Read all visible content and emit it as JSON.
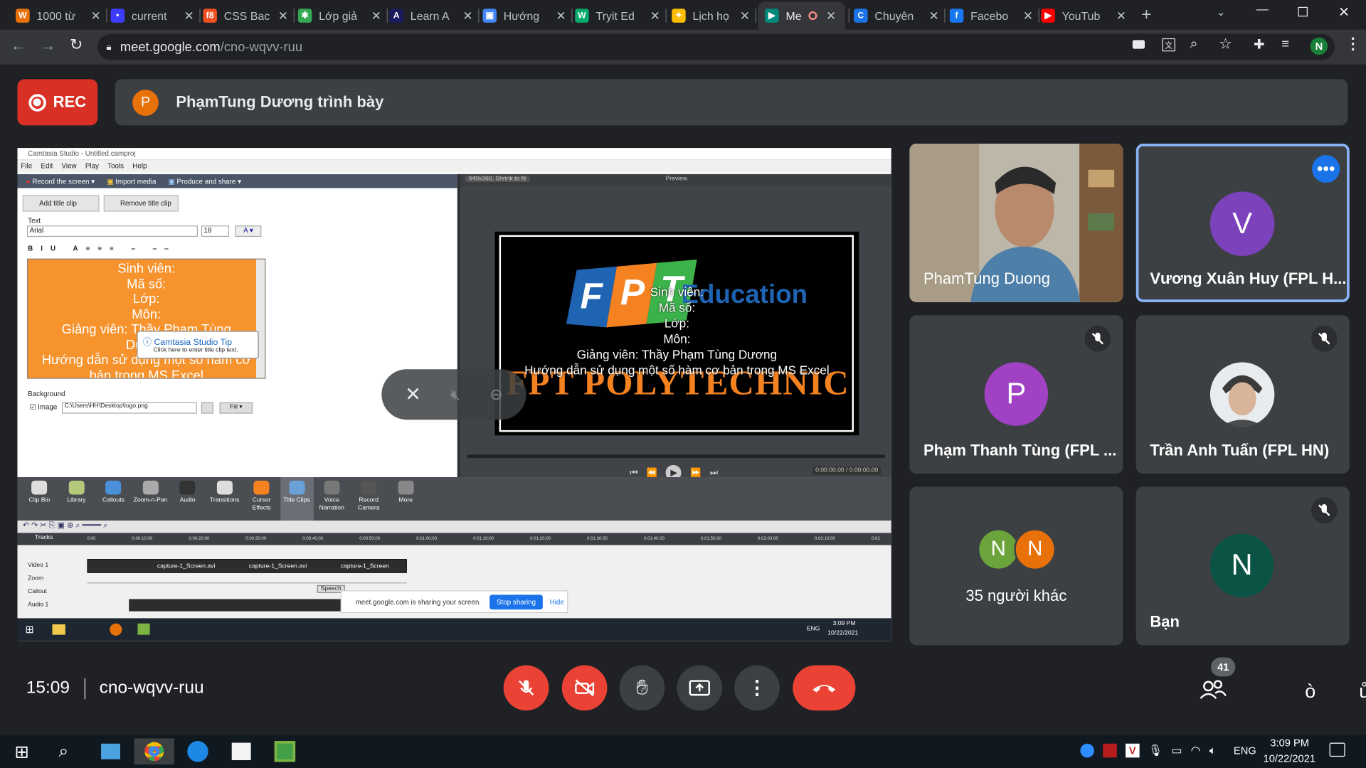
{
  "browser": {
    "tabs": [
      {
        "title": "1000 từ",
        "color": "#e8710a",
        "glyph": "W"
      },
      {
        "title": "current",
        "color": "#3c3cff",
        "glyph": "•"
      },
      {
        "title": "CSS Bac",
        "color": "#f05123",
        "glyph": "f8"
      },
      {
        "title": "Lớp giả",
        "color": "#34a853",
        "glyph": "✱"
      },
      {
        "title": "Learn A",
        "color": "#1a1a5e",
        "glyph": "A"
      },
      {
        "title": "Hướng",
        "color": "#4285f4",
        "glyph": "▣"
      },
      {
        "title": "Tryit Ed",
        "color": "#04aa6d",
        "glyph": "W"
      },
      {
        "title": "Lịch họ",
        "color": "#fbbc04",
        "glyph": "✦"
      },
      {
        "title": "Me",
        "color": "#00897b",
        "glyph": "▶"
      },
      {
        "title": "Chuyên",
        "color": "#1a73e8",
        "glyph": "C"
      },
      {
        "title": "Facebo",
        "color": "#1877f2",
        "glyph": "f"
      },
      {
        "title": "YouTub",
        "color": "#ff0000",
        "glyph": "▶"
      }
    ],
    "url_domain": "meet.google.com",
    "url_path": "/cno-wqvv-ruu",
    "profile_initial": "N"
  },
  "meeting": {
    "rec_label": "REC",
    "presenter_initial": "P",
    "presenter_text": "PhạmTung Dương trình bày",
    "clock": "15:09",
    "code": "cno-wqvv-ruu",
    "participant_count": "41",
    "right_char": "ò",
    "edge_char": "ů"
  },
  "tiles": [
    {
      "name": "PhamTung Duong",
      "type": "video"
    },
    {
      "name": "Vương Xuân Huy (FPL H...",
      "initial": "V",
      "color": "#7b42bc"
    },
    {
      "name": "Phạm Thanh Tùng (FPL ...",
      "initial": "P",
      "color": "#a142c4"
    },
    {
      "name": "Trần Anh Tuấn (FPL HN)",
      "type": "photo"
    },
    {
      "name": "35 người khác",
      "initials": [
        "N",
        "N"
      ],
      "colors": [
        "#6ba43a",
        "#e8710a"
      ]
    },
    {
      "name": "Bạn",
      "initial": "N",
      "color": "#0b5345"
    }
  ],
  "camtasia": {
    "title": "Camtasia Studio - Untitled.camproj",
    "menu": [
      "File",
      "Edit",
      "View",
      "Play",
      "Tools",
      "Help"
    ],
    "record_label": "Record the screen",
    "import_label": "Import media",
    "produce_label": "Produce and share",
    "add_title_clip": "Add title clip",
    "remove_title_clip": "Remove title clip",
    "text_label": "Text",
    "font": "Arial",
    "font_size": "18",
    "editor_lines": [
      "Sinh viên:",
      "Mã số:",
      "Lớp:",
      "Môn:",
      "Giảng viên: Thầy Phạm Tùng",
      "Dương",
      "Hướng dẫn sử dụng một số hàm cơ",
      "bản trong MS Excel"
    ],
    "tip_title": "Camtasia Studio Tip",
    "tip_text": "Click here to enter title clip text.",
    "background_label": "Background",
    "image_label": "Image",
    "image_path": "C:\\Users\\HH\\Desktop\\logo.png",
    "fill_label": "Fill",
    "preview_size": "640x360, Shrink to fit",
    "preview_label": "Preview",
    "preview_lines": [
      "Sinh viên:",
      "Mã số:",
      "Lớp:",
      "Môn:",
      "Giảng viên: Thầy Phạm Tùng Dương",
      "Hướng dẫn sử dụng một số hàm cơ bản trong MS Excel"
    ],
    "logo_letters": [
      "F",
      "P",
      "T"
    ],
    "logo_education": "Education",
    "logo_poly": "FPT POLYTECHNIC",
    "time_display": "0:00:00.00 / 0:00:00.00",
    "tools": [
      "Clip Bin",
      "Library",
      "Callouts",
      "Zoom-n-Pan",
      "Audio",
      "Transitions",
      "Cursor Effects",
      "Title Clips",
      "Voice Narration",
      "Record Camera",
      "More"
    ],
    "tracks_label": "Tracks",
    "track_names": [
      "Video 1",
      "Zoom",
      "Callout",
      "Audio 1"
    ],
    "ruler": [
      "0:00",
      "0:00:10;00",
      "0:00:20;00",
      "0:00:30;00",
      "0:00:40;00",
      "0:00:50;00",
      "0:01:00;00",
      "0:01:10;00",
      "0:01:20;00",
      "0:01:30;00",
      "0:01:40;00",
      "0:01:50;00",
      "0:02:00;00",
      "0:02:10;00",
      "0:02"
    ],
    "clips": [
      "capture-1_Screen.avi",
      "capture-1_Screen.avi",
      "capture-1_Screen"
    ],
    "speech": "Speech",
    "share_text": "meet.google.com is sharing your screen.",
    "stop_sharing": "Stop sharing",
    "hide": "Hide",
    "win_lang": "ENG",
    "win_time": "3:09 PM",
    "win_date": "10/22/2021"
  },
  "taskbar": {
    "lang": "ENG",
    "time": "3:09 PM",
    "date": "10/22/2021"
  }
}
